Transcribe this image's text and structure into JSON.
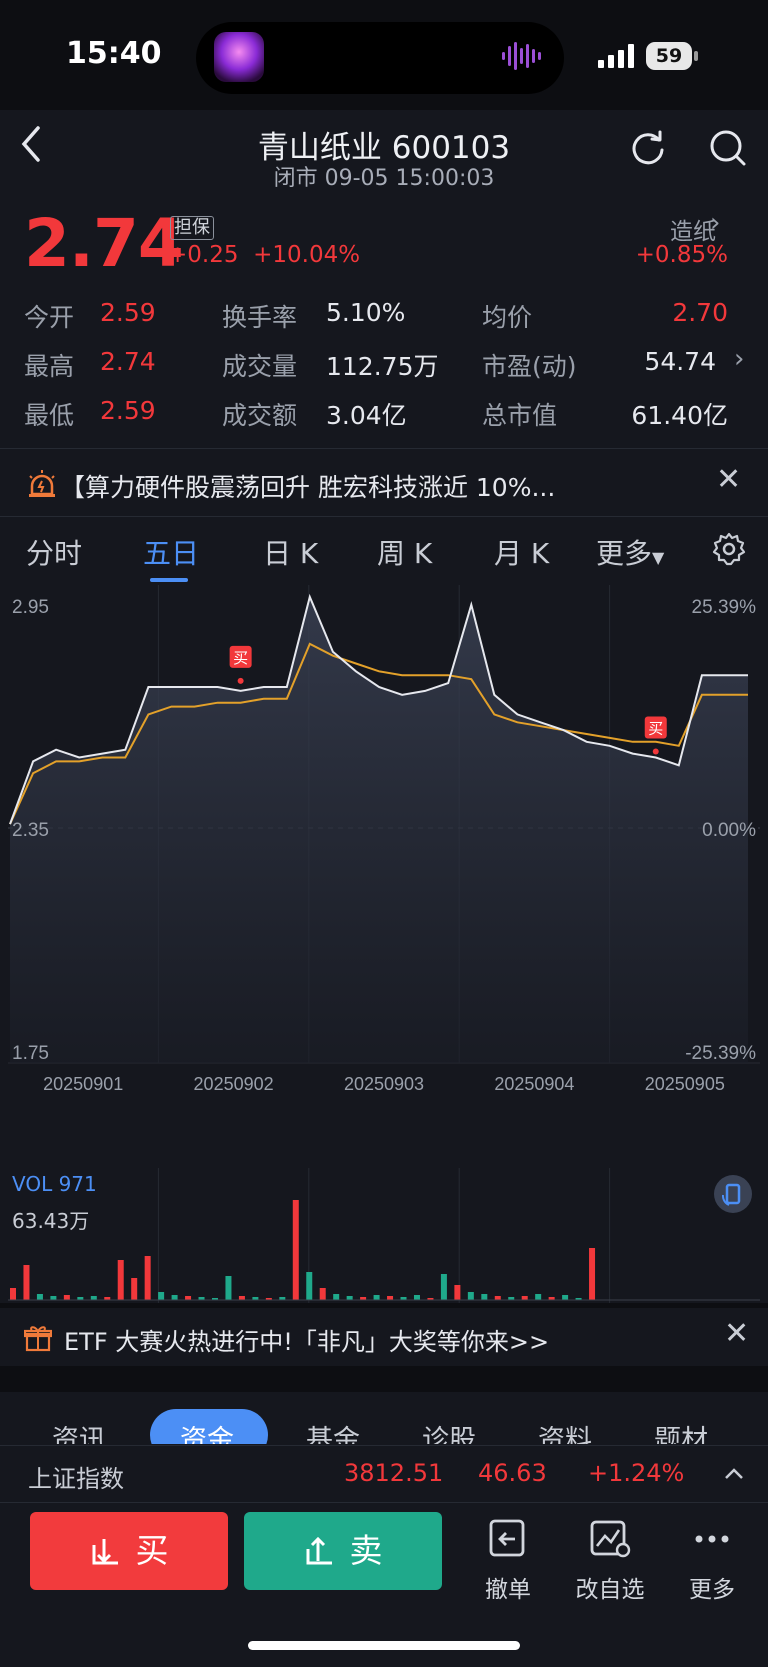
{
  "status": {
    "time": "15:40",
    "battery": "59"
  },
  "header": {
    "title": "青山纸业 600103",
    "subtitle": "闭市 09-05 15:00:03"
  },
  "quote": {
    "price": "2.74",
    "tag": "担保",
    "change": "+0.25",
    "change_pct": "+10.04%",
    "sector": "造纸",
    "sector_pct": "+0.85%"
  },
  "stats": [
    {
      "label": "今开",
      "value": "2.59"
    },
    {
      "label": "换手率",
      "value": "5.10%"
    },
    {
      "label": "均价",
      "value": "2.70"
    },
    {
      "label": "最高",
      "value": "2.74"
    },
    {
      "label": "成交量",
      "value": "112.75万"
    },
    {
      "label": "市盈(动)",
      "value": "54.74"
    },
    {
      "label": "最低",
      "value": "2.59"
    },
    {
      "label": "成交额",
      "value": "3.04亿"
    },
    {
      "label": "总市值",
      "value": "61.40亿"
    }
  ],
  "news": {
    "text": "【算力硬件股震荡回升 胜宏科技涨近 10%..."
  },
  "tabs": [
    "分时",
    "五日",
    "日 K",
    "周 K",
    "月 K",
    "更多"
  ],
  "chart_data": {
    "type": "line",
    "title": "",
    "y_left_ticks": [
      "2.95",
      "2.35",
      "1.75"
    ],
    "y_right_ticks": [
      "25.39%",
      "0.00%",
      "-25.39%"
    ],
    "ylim": [
      1.75,
      2.95
    ],
    "days": [
      "20250901",
      "20250902",
      "20250903",
      "20250904",
      "20250905"
    ],
    "series": [
      {
        "name": "price",
        "color": "#e6e8ee",
        "values": [
          2.36,
          2.52,
          2.55,
          2.53,
          2.54,
          2.55,
          2.71,
          2.71,
          2.71,
          2.71,
          2.7,
          2.71,
          2.71,
          2.94,
          2.8,
          2.75,
          2.71,
          2.69,
          2.7,
          2.72,
          2.92,
          2.69,
          2.64,
          2.62,
          2.6,
          2.57,
          2.56,
          2.54,
          2.53,
          2.51,
          2.74,
          2.74,
          2.74
        ]
      },
      {
        "name": "avg",
        "color": "#e3a12a",
        "values": [
          2.36,
          2.49,
          2.52,
          2.52,
          2.53,
          2.53,
          2.64,
          2.66,
          2.66,
          2.67,
          2.67,
          2.68,
          2.68,
          2.82,
          2.79,
          2.77,
          2.75,
          2.74,
          2.74,
          2.74,
          2.73,
          2.64,
          2.62,
          2.61,
          2.6,
          2.59,
          2.58,
          2.57,
          2.57,
          2.56,
          2.69,
          2.69,
          2.69
        ]
      }
    ],
    "markers": [
      {
        "label": "买",
        "day": "20250902"
      },
      {
        "label": "买",
        "day": "20250904"
      }
    ]
  },
  "volume": {
    "title": "VOL 971",
    "max_label": "63.43万",
    "bars": [
      12,
      35,
      6,
      4,
      5,
      3,
      4,
      3,
      40,
      22,
      44,
      8,
      5,
      4,
      3,
      2,
      24,
      4,
      3,
      2,
      3,
      100,
      28,
      12,
      6,
      4,
      3,
      5,
      4,
      3,
      5,
      2,
      26,
      15,
      8,
      6,
      4,
      3,
      4,
      6,
      3,
      5,
      2,
      52
    ],
    "colors": [
      "r",
      "r",
      "g",
      "g",
      "r",
      "g",
      "g",
      "r",
      "r",
      "r",
      "r",
      "g",
      "g",
      "r",
      "g",
      "g",
      "g",
      "r",
      "g",
      "r",
      "g",
      "r",
      "g",
      "r",
      "g",
      "g",
      "r",
      "g",
      "r",
      "g",
      "g",
      "r",
      "g",
      "r",
      "g",
      "g",
      "r",
      "g",
      "r",
      "g",
      "r",
      "g",
      "g",
      "r"
    ]
  },
  "etf": {
    "text": "ETF 大赛火热进行中!「非凡」大奖等你来>>"
  },
  "bottom_tabs": [
    "资讯",
    "资金",
    "基金",
    "诊股",
    "资料",
    "题材"
  ],
  "index": {
    "name": "上证指数",
    "value": "3812.51",
    "change": "46.63",
    "pct": "+1.24%"
  },
  "actions": {
    "buy": "买",
    "sell": "卖",
    "cancel": "撤单",
    "edit": "改自选",
    "more": "更多"
  },
  "colors": {
    "red": "#f2383b",
    "green": "#1fa98b",
    "blue": "#4c8ff5",
    "avg": "#e3a12a"
  }
}
